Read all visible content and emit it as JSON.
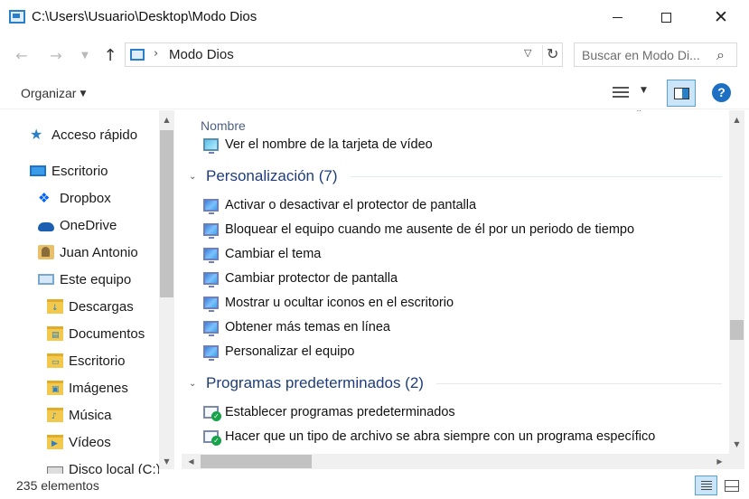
{
  "window": {
    "title": "C:\\Users\\Usuario\\Desktop\\Modo Dios",
    "minimize_icon": "minimize-icon",
    "maximize_icon": "maximize-icon",
    "close_icon": "close-icon"
  },
  "address": {
    "breadcrumb_separator": "›",
    "current": "Modo Dios",
    "search_placeholder": "Buscar en Modo Di..."
  },
  "toolbar": {
    "organize_label": "Organizar"
  },
  "navpane": {
    "items": [
      {
        "label": "Acceso rápido",
        "icon": "star-icon"
      },
      {
        "label": "Escritorio",
        "icon": "desktop-icon"
      },
      {
        "label": "Dropbox",
        "icon": "dropbox-icon"
      },
      {
        "label": "OneDrive",
        "icon": "cloud-icon"
      },
      {
        "label": "Juan Antonio",
        "icon": "user-folder-icon"
      },
      {
        "label": "Este equipo",
        "icon": "computer-icon"
      },
      {
        "label": "Descargas",
        "icon": "downloads-folder-icon"
      },
      {
        "label": "Documentos",
        "icon": "documents-folder-icon"
      },
      {
        "label": "Escritorio",
        "icon": "desktop-folder-icon"
      },
      {
        "label": "Imágenes",
        "icon": "pictures-folder-icon"
      },
      {
        "label": "Música",
        "icon": "music-folder-icon"
      },
      {
        "label": "Vídeos",
        "icon": "videos-folder-icon"
      },
      {
        "label": "Disco local (C:)",
        "icon": "disk-icon"
      }
    ]
  },
  "content": {
    "column_header": "Nombre",
    "top_item": "Ver el nombre de la tarjeta de vídeo",
    "groups": [
      {
        "title": "Personalización (7)",
        "items": [
          "Activar o desactivar el protector de pantalla",
          "Bloquear el equipo cuando me ausente de él por un periodo de tiempo",
          "Cambiar el tema",
          "Cambiar protector de pantalla",
          "Mostrar u ocultar iconos en el escritorio",
          "Obtener más temas en línea",
          "Personalizar el equipo"
        ]
      },
      {
        "title": "Programas predeterminados (2)",
        "items": [
          "Establecer programas predeterminados",
          "Hacer que un tipo de archivo se abra siempre con un programa específico"
        ]
      }
    ]
  },
  "status": {
    "item_count": "235 elementos"
  }
}
